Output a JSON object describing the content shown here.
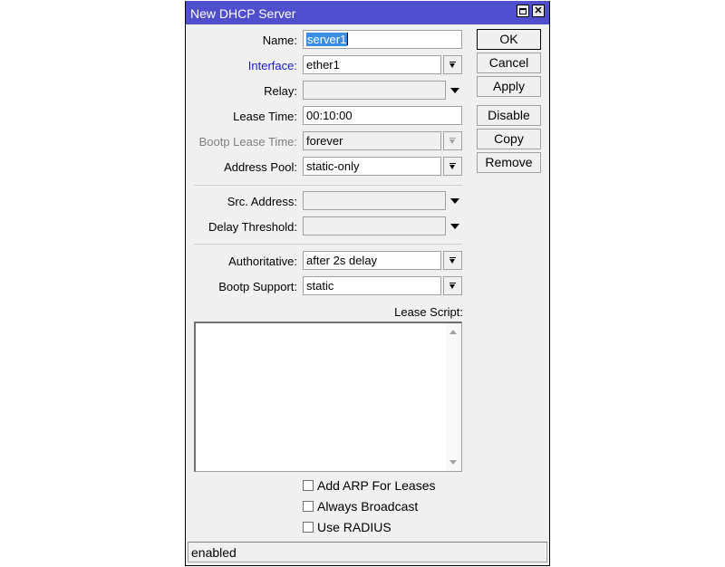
{
  "window": {
    "title": "New DHCP Server",
    "maximize_icon": "maximize-icon",
    "close_icon": "close-icon"
  },
  "form": {
    "name": {
      "label": "Name:",
      "value": "server1"
    },
    "interface": {
      "label": "Interface:",
      "value": "ether1"
    },
    "relay": {
      "label": "Relay:",
      "value": ""
    },
    "lease_time": {
      "label": "Lease Time:",
      "value": "00:10:00"
    },
    "bootp_lease_time": {
      "label": "Bootp Lease Time:",
      "value": "forever"
    },
    "address_pool": {
      "label": "Address Pool:",
      "value": "static-only"
    },
    "src_address": {
      "label": "Src. Address:",
      "value": ""
    },
    "delay_threshold": {
      "label": "Delay Threshold:",
      "value": ""
    },
    "authoritative": {
      "label": "Authoritative:",
      "value": "after 2s delay"
    },
    "bootp_support": {
      "label": "Bootp Support:",
      "value": "static"
    },
    "lease_script": {
      "label": "Lease Script:",
      "value": ""
    },
    "checkboxes": [
      {
        "label": "Add ARP For Leases",
        "checked": false
      },
      {
        "label": "Always Broadcast",
        "checked": false
      },
      {
        "label": "Use RADIUS",
        "checked": false
      }
    ]
  },
  "buttons": {
    "ok": "OK",
    "cancel": "Cancel",
    "apply": "Apply",
    "disable": "Disable",
    "copy": "Copy",
    "remove": "Remove"
  },
  "status": "enabled",
  "colors": {
    "titlebar": "#4f4fcd",
    "link_label": "#1a1ad0",
    "selection": "#3a8ee6"
  }
}
